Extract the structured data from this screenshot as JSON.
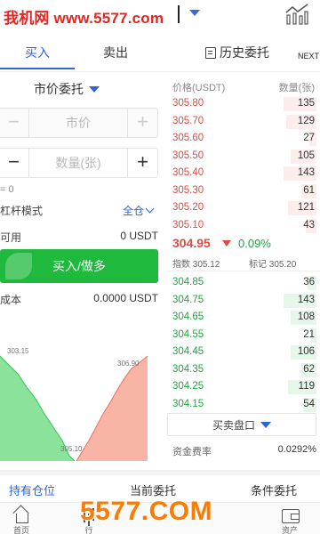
{
  "watermark": {
    "top": "我机网 www.5577.com",
    "bottom": "5577.COM"
  },
  "tabs": {
    "buy": "买入",
    "sell": "卖出",
    "history": "历史委托",
    "next": "NEXT"
  },
  "form": {
    "order_type": "市价委托",
    "price_placeholder": "市价",
    "qty_placeholder": "数量(张)",
    "min_note": "= 0",
    "leverage_label": "杠杆模式",
    "leverage_value": "全仓",
    "available_label": "可用",
    "available_value": "0 USDT",
    "buy_button": "买入/做多",
    "cost_label": "成本",
    "cost_value": "0.0000 USDT"
  },
  "depth_labels": {
    "left": "303.15",
    "right": "306.90",
    "mid": "305.10"
  },
  "orderbook": {
    "header_price": "价格(USDT)",
    "header_qty": "数量(张)",
    "asks": [
      {
        "price": "305.80",
        "qty": "135",
        "depth": 0.22
      },
      {
        "price": "305.70",
        "qty": "129",
        "depth": 0.2
      },
      {
        "price": "305.60",
        "qty": "27",
        "depth": 0.05
      },
      {
        "price": "305.50",
        "qty": "105",
        "depth": 0.17
      },
      {
        "price": "305.40",
        "qty": "143",
        "depth": 0.22
      },
      {
        "price": "305.30",
        "qty": "61",
        "depth": 0.1
      },
      {
        "price": "305.20",
        "qty": "121",
        "depth": 0.19
      },
      {
        "price": "305.10",
        "qty": "43",
        "depth": 0.07
      }
    ],
    "last_price": "304.95",
    "change": "0.09%",
    "index_label": "指数 305.12",
    "mark_label": "标记 305.20",
    "bids": [
      {
        "price": "304.85",
        "qty": "36",
        "depth": 0.06
      },
      {
        "price": "304.75",
        "qty": "143",
        "depth": 0.22
      },
      {
        "price": "304.65",
        "qty": "108",
        "depth": 0.17
      },
      {
        "price": "304.55",
        "qty": "21",
        "depth": 0.04
      },
      {
        "price": "304.45",
        "qty": "106",
        "depth": 0.17
      },
      {
        "price": "304.35",
        "qty": "62",
        "depth": 0.1
      },
      {
        "price": "304.25",
        "qty": "119",
        "depth": 0.19
      },
      {
        "price": "304.15",
        "qty": "54",
        "depth": 0.09
      }
    ],
    "depth_select": "买卖盘口",
    "funding_label": "资金费率",
    "funding_value": "0.0292%"
  },
  "bottom_tabs": {
    "positions": "持有仓位",
    "open_orders": "当前委托",
    "conditional": "条件委托"
  },
  "nav": {
    "home": "首页",
    "market": "行",
    "trade": "",
    "asset": "资产"
  },
  "colors": {
    "accent": "#2d64d8",
    "up": "#1fb93e",
    "down": "#e04a3f"
  }
}
